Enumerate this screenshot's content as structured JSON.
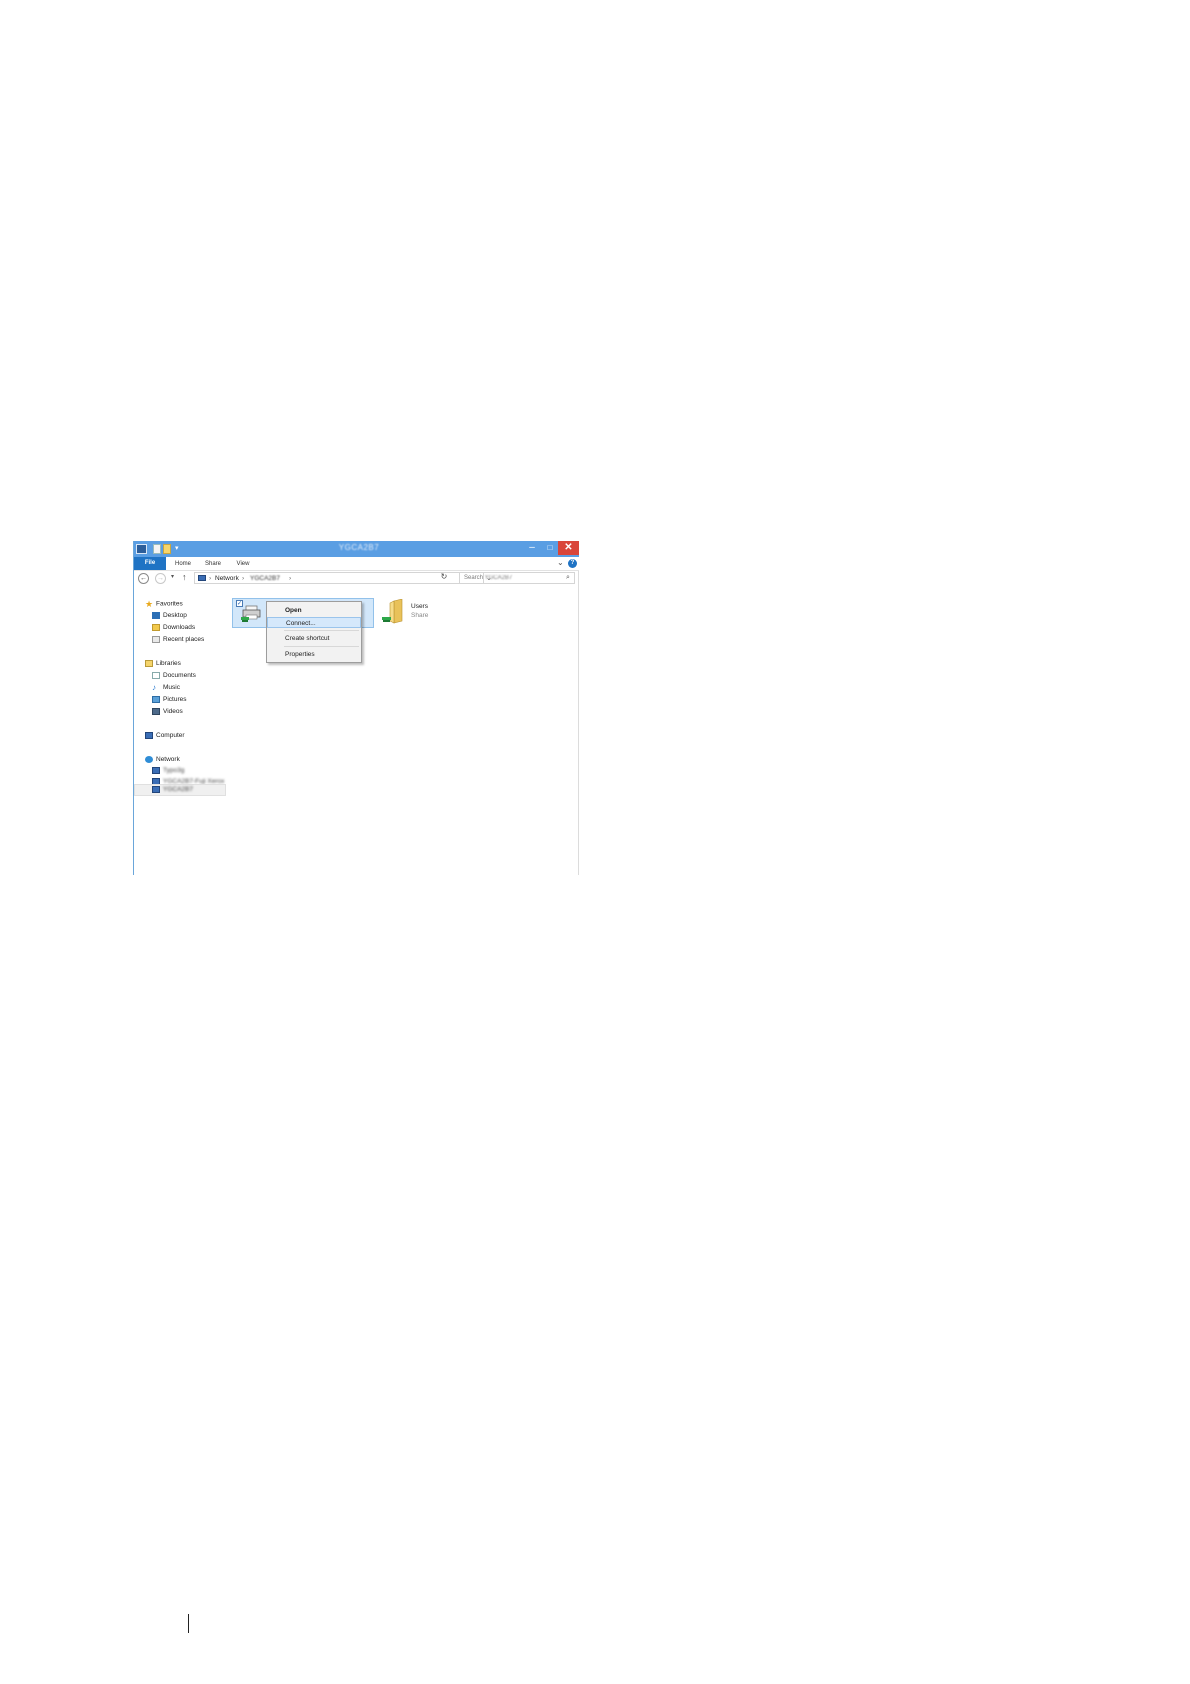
{
  "window": {
    "title": "YGCA2B7",
    "minimize_label": "–",
    "maximize_label": "□",
    "close_label": "✕"
  },
  "ribbon": {
    "tabs": [
      {
        "label": "File"
      },
      {
        "label": "Home"
      },
      {
        "label": "Share"
      },
      {
        "label": "View"
      }
    ],
    "collapse_glyph": "⌄",
    "help_glyph": "?"
  },
  "address_bar": {
    "back_glyph": "←",
    "forward_glyph": "→",
    "recent_glyph": "▾",
    "up_glyph": "↑",
    "breadcrumbs": [
      "Network",
      "YGCA2B7"
    ],
    "separator": "›",
    "dropdown_glyph": "⌄",
    "refresh_glyph": "↻"
  },
  "search": {
    "prefix": "Search",
    "scope": "YGCA2B7",
    "icon_glyph": "⌕"
  },
  "nav_pane": {
    "favorites": {
      "label": "Favorites",
      "items": [
        "Desktop",
        "Downloads",
        "Recent places"
      ]
    },
    "libraries": {
      "label": "Libraries",
      "items": [
        "Documents",
        "Music",
        "Pictures",
        "Videos"
      ]
    },
    "computer": {
      "label": "Computer"
    },
    "network": {
      "label": "Network",
      "items": [
        "Typo3g",
        "YGCA2B7-Fuji Xerox",
        "YGCA2B7"
      ]
    },
    "icons": {
      "favorites": "star-icon",
      "music": "music-note-icon"
    },
    "star_glyph": "★",
    "music_glyph": "♪"
  },
  "content": {
    "checkbox_glyph": "✓",
    "share": {
      "name": "Users",
      "description": "Share"
    }
  },
  "context_menu": {
    "items": [
      "Open",
      "Connect...",
      "Create shortcut",
      "Properties"
    ]
  },
  "colors": {
    "titlebar": "#5a9ee3",
    "file_tab": "#1f73c4",
    "close_button": "#d9463a",
    "selection": "#d2e7fa"
  }
}
